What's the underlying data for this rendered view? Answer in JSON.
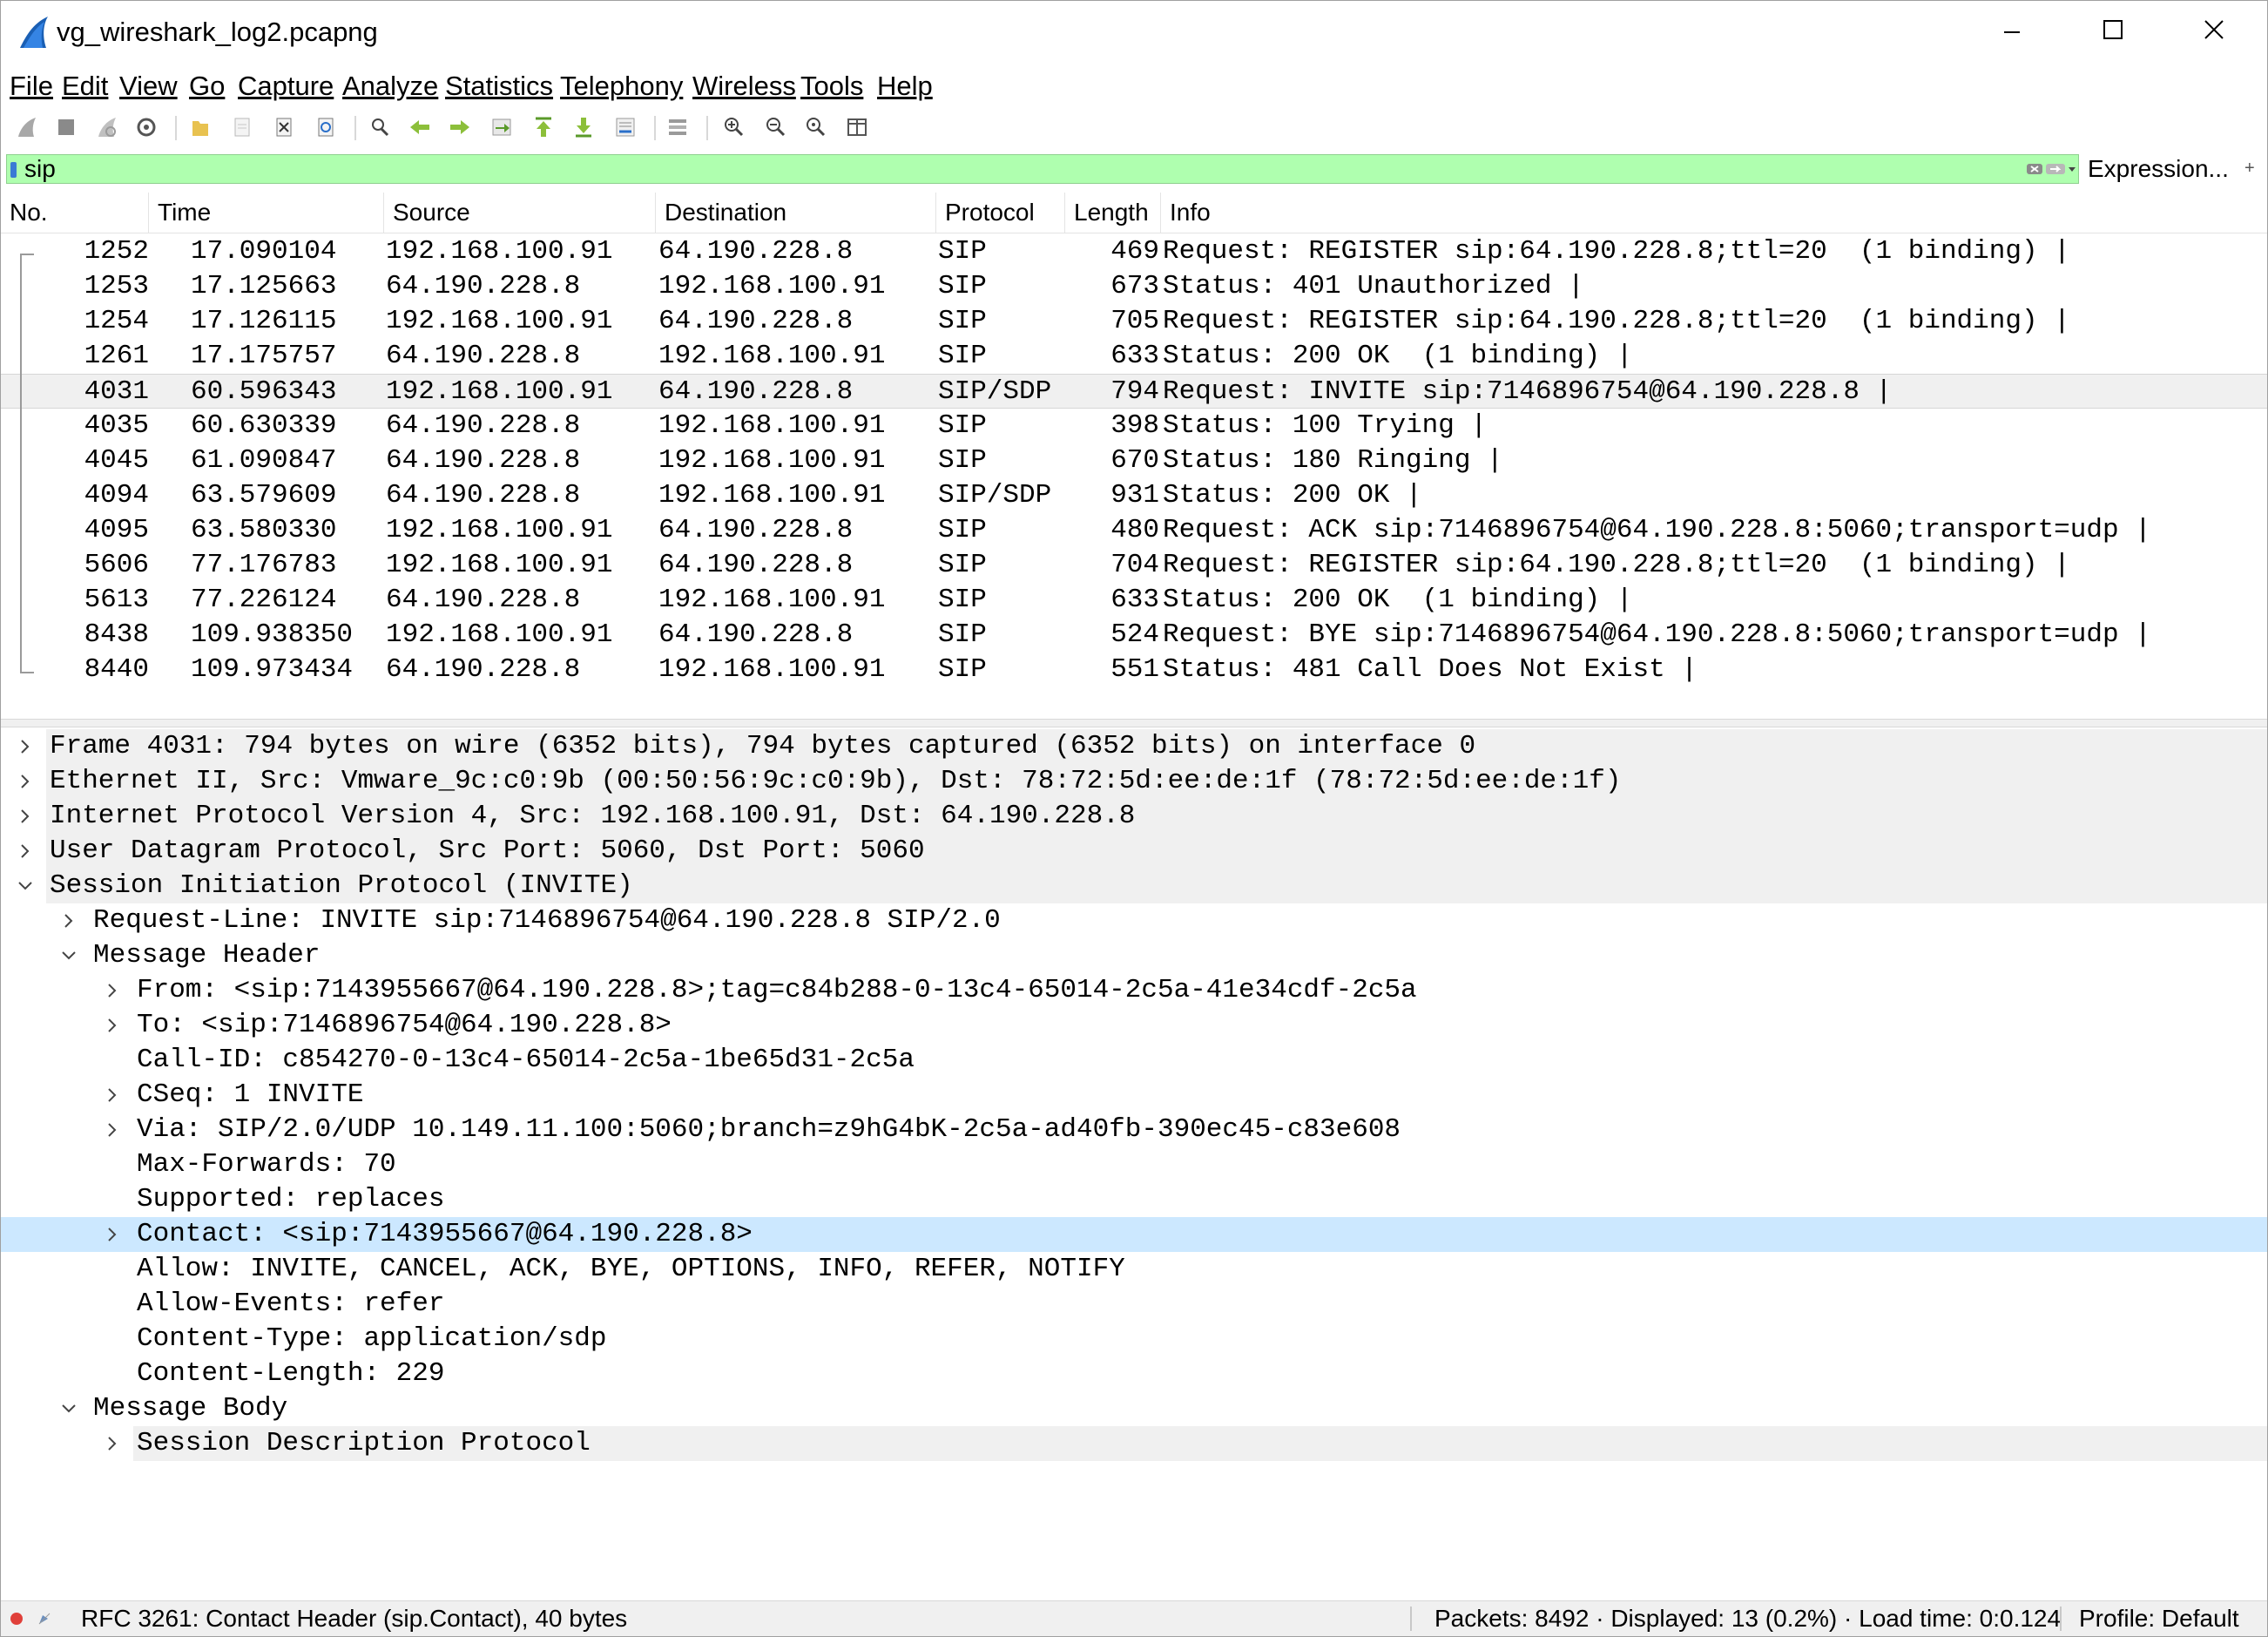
{
  "window": {
    "title": "vg_wireshark_log2.pcapng"
  },
  "menu": [
    {
      "label": "File"
    },
    {
      "label": "Edit"
    },
    {
      "label": "View"
    },
    {
      "label": "Go"
    },
    {
      "label": "Capture"
    },
    {
      "label": "Analyze"
    },
    {
      "label": "Statistics"
    },
    {
      "label": "Telephony"
    },
    {
      "label": "Wireless"
    },
    {
      "label": "Tools"
    },
    {
      "label": "Help"
    }
  ],
  "toolbar_icons": [
    "start-capture-icon",
    "stop-capture-icon",
    "restart-capture-icon",
    "capture-options-icon",
    "open-file-icon",
    "save-file-icon",
    "close-file-icon",
    "reload-file-icon",
    "find-packet-icon",
    "go-back-icon",
    "go-forward-icon",
    "go-to-packet-icon",
    "first-packet-icon",
    "last-packet-icon",
    "autoscroll-icon",
    "colorize-icon",
    "zoom-in-icon",
    "zoom-out-icon",
    "zoom-normal-icon",
    "resize-columns-icon"
  ],
  "filter": {
    "value": "sip",
    "expression_label": "Expression...",
    "plus_label": "+"
  },
  "packet_list": {
    "columns": [
      "No.",
      "Time",
      "Source",
      "Destination",
      "Protocol",
      "Length",
      "Info"
    ],
    "rows": [
      {
        "no": "1252",
        "time": "17.090104",
        "src": "192.168.100.91",
        "dst": "64.190.228.8",
        "proto": "SIP",
        "len": "469",
        "info": "Request: REGISTER sip:64.190.228.8;ttl=20  (1 binding) |"
      },
      {
        "no": "1253",
        "time": "17.125663",
        "src": "64.190.228.8",
        "dst": "192.168.100.91",
        "proto": "SIP",
        "len": "673",
        "info": "Status: 401 Unauthorized |"
      },
      {
        "no": "1254",
        "time": "17.126115",
        "src": "192.168.100.91",
        "dst": "64.190.228.8",
        "proto": "SIP",
        "len": "705",
        "info": "Request: REGISTER sip:64.190.228.8;ttl=20  (1 binding) |"
      },
      {
        "no": "1261",
        "time": "17.175757",
        "src": "64.190.228.8",
        "dst": "192.168.100.91",
        "proto": "SIP",
        "len": "633",
        "info": "Status: 200 OK  (1 binding) |"
      },
      {
        "no": "4031",
        "time": "60.596343",
        "src": "192.168.100.91",
        "dst": "64.190.228.8",
        "proto": "SIP/SDP",
        "len": "794",
        "info": "Request: INVITE sip:7146896754@64.190.228.8 |",
        "selected": true
      },
      {
        "no": "4035",
        "time": "60.630339",
        "src": "64.190.228.8",
        "dst": "192.168.100.91",
        "proto": "SIP",
        "len": "398",
        "info": "Status: 100 Trying |"
      },
      {
        "no": "4045",
        "time": "61.090847",
        "src": "64.190.228.8",
        "dst": "192.168.100.91",
        "proto": "SIP",
        "len": "670",
        "info": "Status: 180 Ringing |"
      },
      {
        "no": "4094",
        "time": "63.579609",
        "src": "64.190.228.8",
        "dst": "192.168.100.91",
        "proto": "SIP/SDP",
        "len": "931",
        "info": "Status: 200 OK |"
      },
      {
        "no": "4095",
        "time": "63.580330",
        "src": "192.168.100.91",
        "dst": "64.190.228.8",
        "proto": "SIP",
        "len": "480",
        "info": "Request: ACK sip:7146896754@64.190.228.8:5060;transport=udp |"
      },
      {
        "no": "5606",
        "time": "77.176783",
        "src": "192.168.100.91",
        "dst": "64.190.228.8",
        "proto": "SIP",
        "len": "704",
        "info": "Request: REGISTER sip:64.190.228.8;ttl=20  (1 binding) |"
      },
      {
        "no": "5613",
        "time": "77.226124",
        "src": "64.190.228.8",
        "dst": "192.168.100.91",
        "proto": "SIP",
        "len": "633",
        "info": "Status: 200 OK  (1 binding) |"
      },
      {
        "no": "8438",
        "time": "109.938350",
        "src": "192.168.100.91",
        "dst": "64.190.228.8",
        "proto": "SIP",
        "len": "524",
        "info": "Request: BYE sip:7146896754@64.190.228.8:5060;transport=udp |"
      },
      {
        "no": "8440",
        "time": "109.973434",
        "src": "64.190.228.8",
        "dst": "192.168.100.91",
        "proto": "SIP",
        "len": "551",
        "info": "Status: 481 Call Does Not Exist |"
      }
    ]
  },
  "details": [
    {
      "level": 0,
      "arrow": "right",
      "text": "Frame 4031: 794 bytes on wire (6352 bits), 794 bytes captured (6352 bits) on interface 0",
      "shade": true
    },
    {
      "level": 0,
      "arrow": "right",
      "text": "Ethernet II, Src: Vmware_9c:c0:9b (00:50:56:9c:c0:9b), Dst: 78:72:5d:ee:de:1f (78:72:5d:ee:de:1f)",
      "shade": true
    },
    {
      "level": 0,
      "arrow": "right",
      "text": "Internet Protocol Version 4, Src: 192.168.100.91, Dst: 64.190.228.8",
      "shade": true
    },
    {
      "level": 0,
      "arrow": "right",
      "text": "User Datagram Protocol, Src Port: 5060, Dst Port: 5060",
      "shade": true
    },
    {
      "level": 0,
      "arrow": "down",
      "text": "Session Initiation Protocol (INVITE)",
      "shade": true
    },
    {
      "level": 1,
      "arrow": "right",
      "text": "Request-Line: INVITE sip:7146896754@64.190.228.8 SIP/2.0"
    },
    {
      "level": 1,
      "arrow": "down",
      "text": "Message Header"
    },
    {
      "level": 2,
      "arrow": "right",
      "text": "From: <sip:7143955667@64.190.228.8>;tag=c84b288-0-13c4-65014-2c5a-41e34cdf-2c5a"
    },
    {
      "level": 2,
      "arrow": "right",
      "text": "To: <sip:7146896754@64.190.228.8>"
    },
    {
      "level": 2,
      "arrow": "none",
      "text": "Call-ID: c854270-0-13c4-65014-2c5a-1be65d31-2c5a"
    },
    {
      "level": 2,
      "arrow": "right",
      "text": "CSeq: 1 INVITE"
    },
    {
      "level": 2,
      "arrow": "right",
      "text": "Via: SIP/2.0/UDP 10.149.11.100:5060;branch=z9hG4bK-2c5a-ad40fb-390ec45-c83e608"
    },
    {
      "level": 2,
      "arrow": "none",
      "text": "Max-Forwards: 70"
    },
    {
      "level": 2,
      "arrow": "none",
      "text": "Supported: replaces"
    },
    {
      "level": 2,
      "arrow": "right",
      "text": "Contact: <sip:7143955667@64.190.228.8>",
      "selected": true
    },
    {
      "level": 2,
      "arrow": "none",
      "text": "Allow: INVITE, CANCEL, ACK, BYE, OPTIONS, INFO, REFER, NOTIFY"
    },
    {
      "level": 2,
      "arrow": "none",
      "text": "Allow-Events: refer"
    },
    {
      "level": 2,
      "arrow": "none",
      "text": "Content-Type: application/sdp"
    },
    {
      "level": 2,
      "arrow": "none",
      "text": "Content-Length: 229"
    },
    {
      "level": 1,
      "arrow": "down",
      "text": "Message Body"
    },
    {
      "level": 2,
      "arrow": "right",
      "text": "Session Description Protocol",
      "shade": true
    }
  ],
  "status": {
    "field": "RFC 3261: Contact Header (sip.Contact), 40 bytes",
    "packets": "Packets: 8492 · Displayed: 13 (0.2%) · Load time: 0:0.124",
    "profile": "Profile: Default"
  },
  "colors": {
    "filter_bg": "#afffaf",
    "selected_detail": "#cce8ff",
    "selected_packet": "#f0f0f0"
  }
}
